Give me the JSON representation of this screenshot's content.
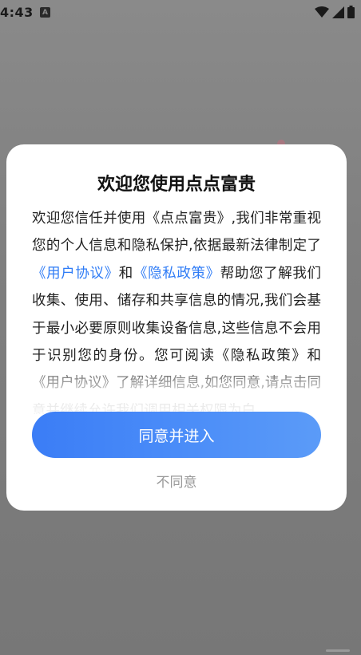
{
  "status_bar": {
    "time": "4:43",
    "badge": "A"
  },
  "dialog": {
    "title": "欢迎您使用点点富贵",
    "body": {
      "p1": "欢迎您信任并使用《点点富贵》,我们非常重视您的个人信息和隐私保护,依据最新法律制定了",
      "link_user_agreement": "《用户协议》",
      "and": "和",
      "link_privacy_policy": "《隐私政策》",
      "p2": "帮助您了解我们收集、使用、储存和共享信息的情况,我们会基于最小必要原则收集设备信息,这些信息不会用于识别您的身份。您可阅读《隐私政策》和《用户协议》了解详细信息,如您同意,请点击同意并继续允许我们调用相关权限为白"
    },
    "agree_label": "同意并进入",
    "disagree_label": "不同意"
  },
  "colors": {
    "accent": "#3b7df6",
    "link": "#2f7cf6",
    "overlay": "#7f7f7f"
  }
}
